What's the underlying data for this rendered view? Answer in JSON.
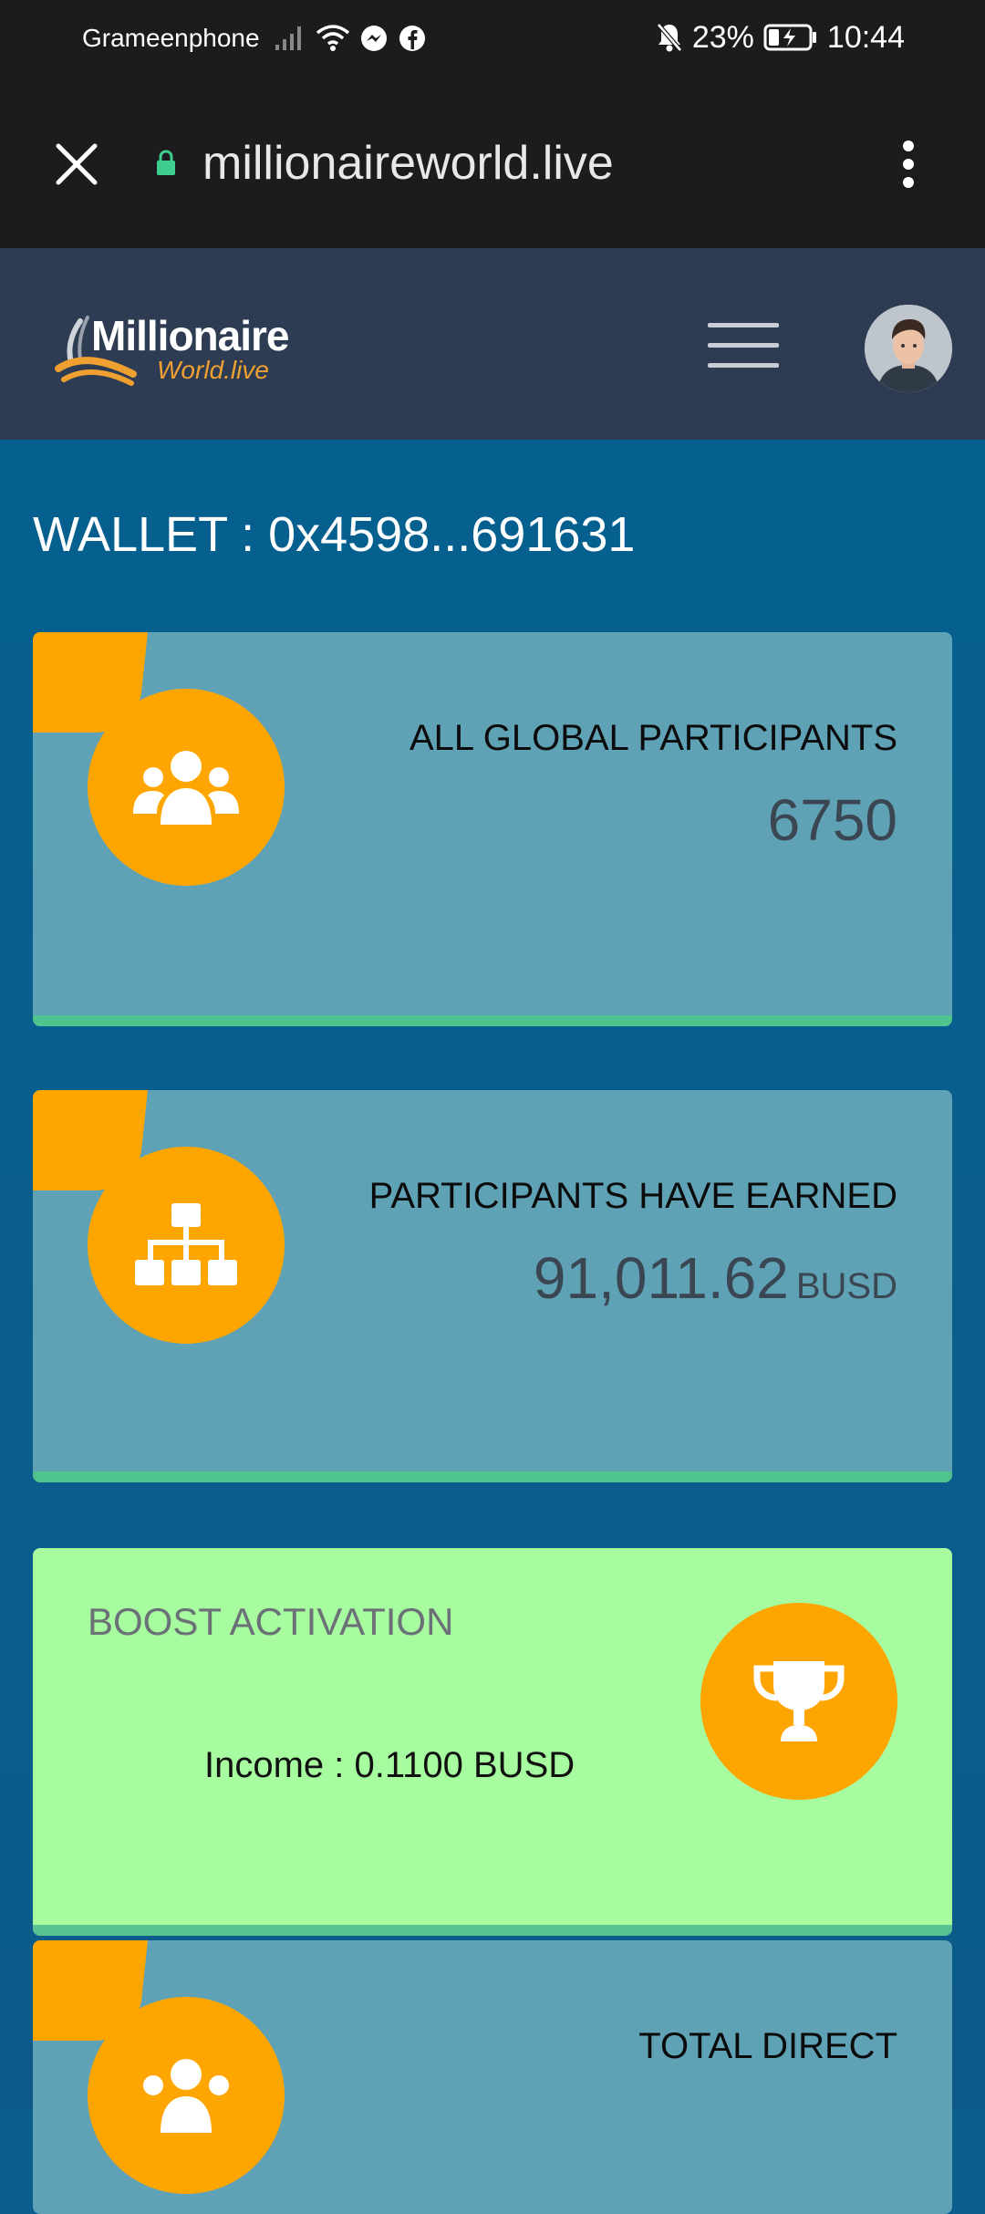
{
  "status_bar": {
    "carrier": "Grameenphone",
    "battery": "23%",
    "time": "10:44"
  },
  "browser": {
    "url": "millionaireworld.live"
  },
  "header": {
    "logo_title": "Millionaire",
    "logo_subtitle": "World.live"
  },
  "main": {
    "wallet_label": "WALLET : 0x4598...691631",
    "cards": [
      {
        "title": "ALL GLOBAL PARTICIPANTS",
        "value": "6750",
        "icon": "users-group-icon"
      },
      {
        "title": "PARTICIPANTS HAVE EARNED",
        "value": "91,011.62",
        "unit": "BUSD",
        "icon": "network-tree-icon"
      },
      {
        "title": "BOOST ACTIVATION",
        "income": "Income : 0.1100 BUSD",
        "icon": "trophy-icon"
      },
      {
        "title": "TOTAL DIRECT",
        "icon": "users-group-icon"
      }
    ]
  },
  "colors": {
    "accent_orange": "#ffa500",
    "card_blue": "#60a2b5",
    "card_green": "#a6fc9e",
    "page_blue": "#0b5f8e",
    "header_dark": "#2d3c52"
  }
}
